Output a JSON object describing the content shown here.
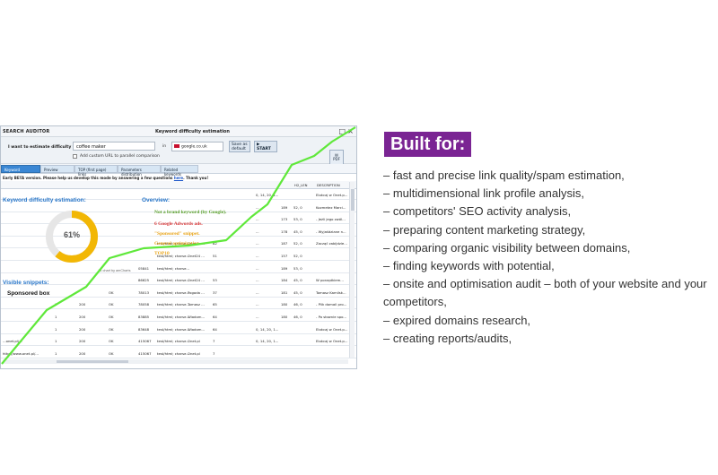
{
  "app": {
    "name": "SEARCH AUDITOR",
    "window_title": "Keyword difficulty estimation",
    "close_glyph": "×",
    "maximize_glyph": "□"
  },
  "toolbar": {
    "question": "I want to estimate difficulty for...",
    "keyword_value": "coffee maker",
    "in_label": "in",
    "engine_value": "google.co.uk",
    "custom_url_label": "Add custom URL to parallel comparison",
    "save_default_label": "Save as default",
    "start_label": "START",
    "report_label": "PDF"
  },
  "tabs": [
    {
      "label": "Keyword summary",
      "active": true
    },
    {
      "label": "Preview",
      "active": false
    },
    {
      "label": "TOP (first page) links",
      "active": false
    },
    {
      "label": "Parameters distribution",
      "active": false
    },
    {
      "label": "Related keywords",
      "active": false
    }
  ],
  "beta_notice": {
    "text": "Early BETA version. Please help us develop this mode by answering a few questions",
    "link": "here",
    "suffix": ". Thank you!"
  },
  "summary": {
    "difficulty_label": "Keyword difficulty estimation:",
    "difficulty_value": "61%",
    "difficulty_fraction": 0.61,
    "chart_credit": "JS chart by amCharts",
    "overview_label": "Overview:",
    "overview_items": [
      {
        "text": "Not a brand keyword (by Google).",
        "color": "#5aa02c"
      },
      {
        "text": "6 Google Adwords ads.",
        "color": "#d93a3a"
      },
      {
        "text": "\"Sponsored\" snippet.",
        "color": "#e8a317"
      },
      {
        "text": "General optimization",
        "color": "#e8a317"
      },
      {
        "text": "TOP10",
        "color": "#e8a317"
      }
    ],
    "visible_snippets_label": "Visible snippets:",
    "sponsored_box_label": "Sponsored box"
  },
  "grid": {
    "headers": [
      "H2_LEN",
      "DESCRIPTION"
    ],
    "rows": [
      [
        "",
        "",
        "",
        "",
        "",
        "",
        "",
        "",
        "",
        "",
        "0, 14, 20, 1...",
        "",
        "",
        "Elokcaj w Onet.p..."
      ],
      [
        "",
        "",
        "",
        "",
        "",
        "",
        "",
        "",
        "",
        "",
        "...",
        "189",
        "52, 0",
        "Kozmetez Marci..."
      ],
      [
        "",
        "",
        "",
        "",
        "",
        "",
        "",
        "",
        "",
        "",
        "...",
        "173",
        "53, 0",
        "- Jeżli jego zwól..."
      ],
      [
        "",
        "",
        "",
        "",
        "",
        "",
        "",
        "",
        "",
        "",
        "...",
        "178",
        "45, 0",
        "- Wyjaśdziane n..."
      ],
      [
        "",
        "",
        "",
        "",
        "",
        "test/html; charse...",
        "Onet Ro...",
        "82",
        "",
        "",
        "...",
        "187",
        "52, 0",
        "Zacząć zabijdzie..."
      ],
      [
        "",
        "",
        "",
        "",
        "",
        "test/html; charse...",
        "Onet24 ...",
        "51",
        "",
        "",
        "...",
        "157",
        "52, 0",
        ""
      ],
      [
        "",
        "",
        "",
        "",
        "05841",
        "test/html; charse...",
        "",
        "",
        "",
        "",
        "...",
        "189",
        "53, 0",
        ""
      ],
      [
        "",
        "",
        "",
        "",
        "86625",
        "test/html; charse...",
        "Onet24 ...",
        "53",
        "",
        "",
        "...",
        "184",
        "45, 0",
        "W porządkiem..."
      ],
      [
        "",
        "",
        "",
        "OK",
        "78013",
        "test/html; charse...",
        "Pogoda ...",
        "37",
        "",
        "",
        "...",
        "181",
        "45, 0",
        "Tomasz Kamilsk..."
      ],
      [
        "",
        "1",
        "200",
        "OK",
        "78058",
        "test/html; charse...",
        "Tomasz ...",
        "65",
        "",
        "",
        "...",
        "180",
        "46, 0",
        "- Plik domail pro..."
      ],
      [
        "",
        "1",
        "200",
        "OK",
        "83885",
        "test/html; charse...",
        "Wiadom...",
        "64",
        "",
        "",
        "...",
        "180",
        "46, 0",
        "- Po słownie spo..."
      ],
      [
        "",
        "1",
        "200",
        "OK",
        "83648",
        "test/html; charse...",
        "Wiadom...",
        "64",
        "",
        "",
        "0, 14, 20, 1...",
        "",
        "",
        "Elokcaj w Onet.p..."
      ],
      [
        "...onet.pl/...",
        "1",
        "200",
        "OK",
        "415067",
        "test/html; charse...",
        "Onet.pl",
        "7",
        "",
        "",
        "0, 14, 20, 1...",
        "",
        "",
        "Elokcaj w Onet.p..."
      ],
      [
        "http://www.onet.pl/...",
        "1",
        "200",
        "OK",
        "415067",
        "test/html; charse...",
        "Onet.pl",
        "7",
        "",
        "",
        "",
        "",
        "",
        ""
      ]
    ]
  },
  "trend_line_color": "#5fe83a",
  "built_for": {
    "heading": "Built for:",
    "heading_bg": "#7a2493",
    "items": [
      "– fast and precise link quality/spam estimation,",
      "– multidimensional link profile analysis,",
      "– competitors' SEO activity analysis,",
      "– preparing content marketing strategy,",
      "– comparing organic visibility between domains,",
      "– finding keywords with potential,",
      "– onsite and optimisation audit – both of your website and your competitors,",
      "– expired domains research,",
      "– creating reports/audits,"
    ]
  }
}
